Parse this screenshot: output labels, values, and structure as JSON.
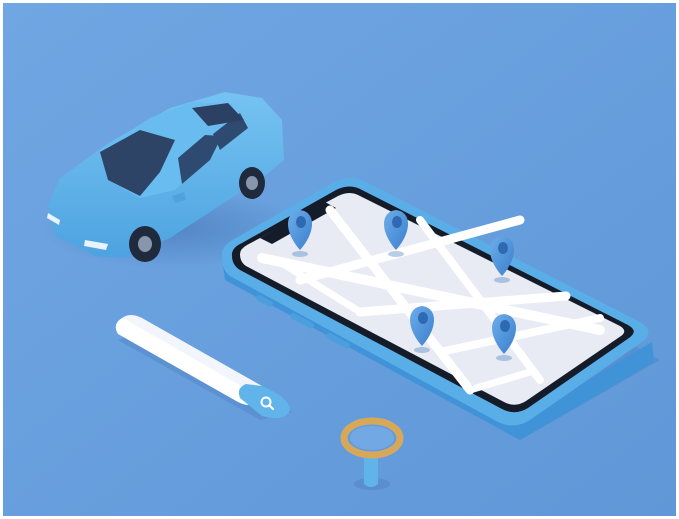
{
  "scene": {
    "subject": "isometric-3d-illustration",
    "elements": [
      "car",
      "smartphone-with-map",
      "location-pin",
      "search-bar",
      "magnifying-glass"
    ],
    "location_pin_count": 5
  },
  "colors": {
    "background": "#6a9fde",
    "car_body": "#5cb1ea",
    "car_window": "#2e4566",
    "phone_frame": "#5aaee8",
    "phone_screen": "#e8ebf3",
    "map_roads": "#ffffff",
    "pins": "#4d91da",
    "search_bar": "#ffffff",
    "search_button": "#61b4ea",
    "magnifier_ring": "#d8a85a"
  },
  "icons": {
    "search_bar_icon": "magnifier-icon"
  }
}
